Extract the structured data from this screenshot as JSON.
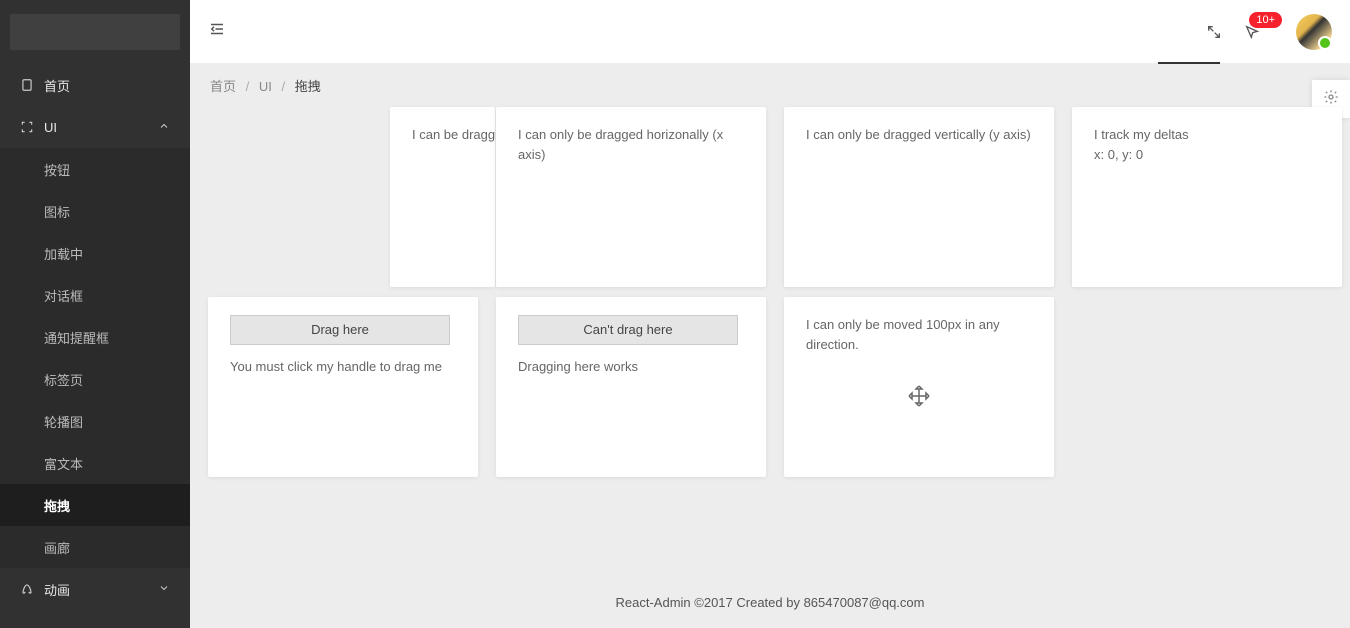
{
  "sidebar": {
    "items": [
      {
        "label": "首页",
        "icon": "device"
      },
      {
        "label": "UI",
        "icon": "expand",
        "expanded": true
      },
      {
        "label": "动画",
        "icon": "rocket"
      }
    ],
    "sub_items": [
      {
        "label": "按钮"
      },
      {
        "label": "图标"
      },
      {
        "label": "加载中"
      },
      {
        "label": "对话框"
      },
      {
        "label": "通知提醒框"
      },
      {
        "label": "标签页"
      },
      {
        "label": "轮播图"
      },
      {
        "label": "富文本"
      },
      {
        "label": "拖拽"
      },
      {
        "label": "画廊"
      }
    ]
  },
  "topbar": {
    "badge": "10+"
  },
  "breadcrumb": {
    "home": "首页",
    "level1": "UI",
    "current": "拖拽"
  },
  "cards": {
    "c1": "I can be dragg",
    "c2": "I can only be dragged horizonally (x axis)",
    "c3": "I can only be dragged vertically (y axis)",
    "c4_line1": "I track my deltas",
    "c4_line2": "x: 0, y: 0",
    "c5_btn": "Drag here",
    "c5_text": "You must click my handle to drag me",
    "c6_btn": "Can't drag here",
    "c6_text": "Dragging here works",
    "c7": "I can only be moved 100px in any direction."
  },
  "footer": "React-Admin ©2017 Created by 865470087@qq.com"
}
